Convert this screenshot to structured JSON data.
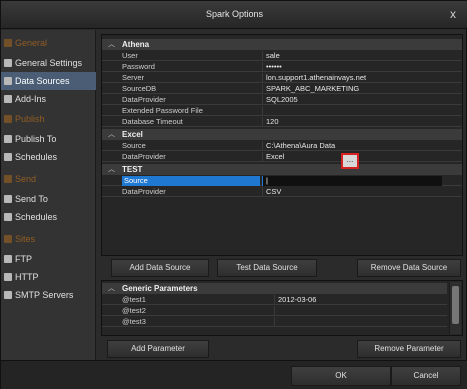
{
  "window": {
    "title": "Spark Options",
    "close_label": "x"
  },
  "sidebar": {
    "items": [
      {
        "label": "General",
        "type": "section"
      },
      {
        "label": "General Settings",
        "type": "item"
      },
      {
        "label": "Data Sources",
        "type": "item",
        "selected": true
      },
      {
        "label": "Add-Ins",
        "type": "item"
      },
      {
        "label": "Publish",
        "type": "section"
      },
      {
        "label": "Publish To",
        "type": "item"
      },
      {
        "label": "Schedules",
        "type": "item"
      },
      {
        "label": "Send",
        "type": "section"
      },
      {
        "label": "Send To",
        "type": "item"
      },
      {
        "label": "Schedules",
        "type": "item"
      },
      {
        "label": "Sites",
        "type": "section"
      },
      {
        "label": "FTP",
        "type": "item"
      },
      {
        "label": "HTTP",
        "type": "item"
      },
      {
        "label": "SMTP Servers",
        "type": "item"
      }
    ]
  },
  "datasources": {
    "groups": [
      {
        "name": "Athena",
        "rows": [
          {
            "name": "User",
            "value": "sale"
          },
          {
            "name": "Password",
            "value": "••••••"
          },
          {
            "name": "Server",
            "value": "lon.support1.athenainvays.net"
          },
          {
            "name": "SourceDB",
            "value": "SPARK_ABC_MARKETING"
          },
          {
            "name": "DataProvider",
            "value": "SQL2005"
          },
          {
            "name": "Extended Password File",
            "value": ""
          },
          {
            "name": "Database Timeout",
            "value": "120"
          }
        ]
      },
      {
        "name": "Excel",
        "rows": [
          {
            "name": "Source",
            "value": "C:\\Athena\\Aura Data"
          },
          {
            "name": "DataProvider",
            "value": "Excel"
          }
        ]
      },
      {
        "name": "TEST",
        "rows": [
          {
            "name": "Source",
            "value": "|"
          },
          {
            "name": "DataProvider",
            "value": "CSV"
          }
        ]
      }
    ],
    "browse_label": "..."
  },
  "buttons": {
    "add_data_source": "Add Data Source",
    "test_data_source": "Test Data Source",
    "remove_data_source": "Remove Data Source",
    "add_parameter": "Add Parameter",
    "remove_parameter": "Remove Parameter",
    "ok": "OK",
    "cancel": "Cancel"
  },
  "parameters": {
    "group_name": "Generic Parameters",
    "rows": [
      {
        "name": "@test1",
        "value": "2012-03-06"
      },
      {
        "name": "@test2",
        "value": ""
      },
      {
        "name": "@test3",
        "value": ""
      }
    ]
  },
  "colors": {
    "selection_blue": "#1f78d1",
    "sidebar_selected": "#4a5d74",
    "section_orange": "#b06a1e",
    "highlight_red": "#d62222"
  }
}
